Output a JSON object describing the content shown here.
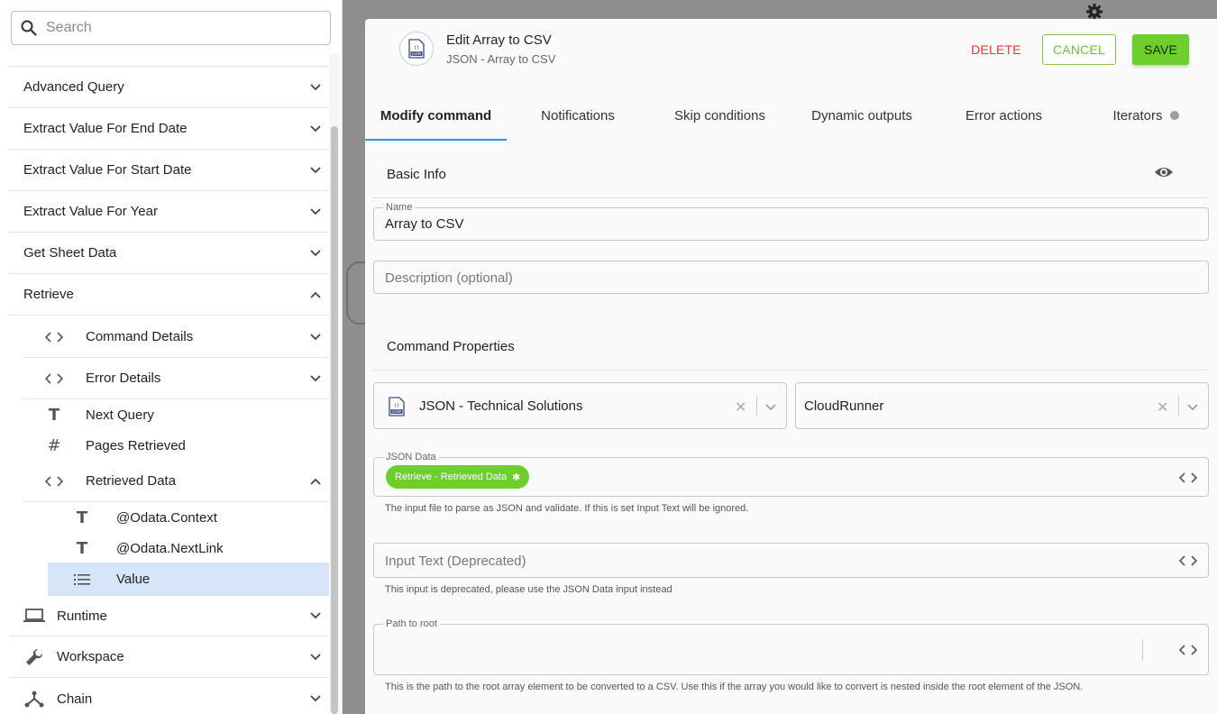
{
  "search": {
    "placeholder": "Search"
  },
  "sidebar": {
    "items": [
      {
        "label": "Advanced Query",
        "chevron": "down"
      },
      {
        "label": "Extract Value For End Date",
        "chevron": "down"
      },
      {
        "label": "Extract Value For Start Date",
        "chevron": "down"
      },
      {
        "label": "Extract Value For Year",
        "chevron": "down"
      },
      {
        "label": "Get Sheet Data",
        "chevron": "down"
      },
      {
        "label": "Retrieve",
        "chevron": "up"
      }
    ],
    "retrieve_children": [
      {
        "label": "Command Details",
        "icon": "code-icon",
        "chevron": "down"
      },
      {
        "label": "Error Details",
        "icon": "code-icon",
        "chevron": "down"
      },
      {
        "label": "Next Query",
        "icon": "text-type-icon"
      },
      {
        "label": "Pages Retrieved",
        "icon": "number-type-icon"
      },
      {
        "label": "Retrieved Data",
        "icon": "code-icon",
        "chevron": "up"
      }
    ],
    "retrieved_data_children": [
      {
        "label": "@Odata.Context",
        "icon": "text-type-icon"
      },
      {
        "label": "@Odata.NextLink",
        "icon": "text-type-icon"
      },
      {
        "label": "Value",
        "icon": "list-icon",
        "selected": true
      }
    ],
    "bottom_items": [
      {
        "label": "Runtime",
        "icon": "laptop-icon",
        "chevron": "down"
      },
      {
        "label": "Workspace",
        "icon": "wrench-icon",
        "chevron": "down"
      },
      {
        "label": "Chain",
        "icon": "chain-icon",
        "chevron": "down"
      }
    ]
  },
  "modal": {
    "title": "Edit Array to CSV",
    "subtitle": "JSON - Array to CSV",
    "delete_label": "DELETE",
    "cancel_label": "CANCEL",
    "save_label": "SAVE",
    "tabs": [
      {
        "label": "Modify command",
        "active": true
      },
      {
        "label": "Notifications"
      },
      {
        "label": "Skip conditions"
      },
      {
        "label": "Dynamic outputs"
      },
      {
        "label": "Error actions"
      },
      {
        "label": "Iterators"
      }
    ],
    "basic_info": {
      "header": "Basic Info",
      "name_label": "Name",
      "name_value": "Array to CSV",
      "description_placeholder": "Description (optional)"
    },
    "command_properties": {
      "header": "Command Properties",
      "connector_value": "JSON - Technical Solutions",
      "runner_value": "CloudRunner",
      "json_data_label": "JSON Data",
      "json_data_chip": "Retrieve - Retrieved Data",
      "json_data_helper": "The input file to parse as JSON and validate. If this is set Input Text will be ignored.",
      "input_text_placeholder": "Input Text (Deprecated)",
      "input_text_helper": "This input is deprecated, please use the JSON Data input instead",
      "path_to_root_label": "Path to root",
      "path_to_root_helper": "This is the path to the root array element to be converted to a CSV. Use this if the array you would like to convert is nested inside the root element of the JSON."
    }
  },
  "colors": {
    "accent_green": "#6dcf2c",
    "delete_red": "#e53935",
    "tab_indicator_blue": "#2196f3",
    "selected_row_bg": "#d6e6f8",
    "canvas_gray": "#8e8e8e"
  }
}
